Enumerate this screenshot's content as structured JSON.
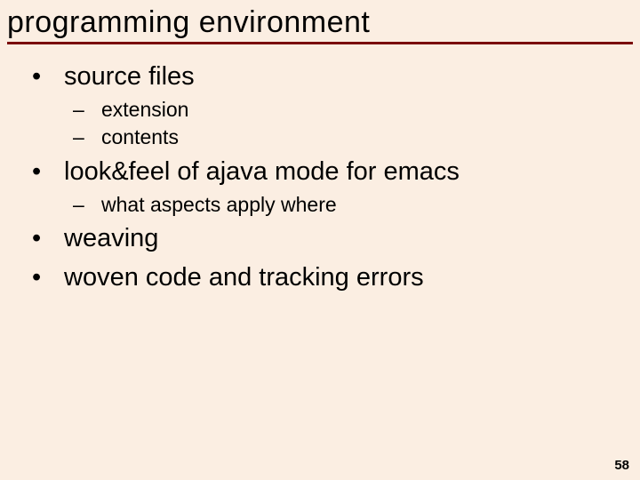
{
  "title": "programming environment",
  "bullets": {
    "b1": "source files",
    "b1a": "extension",
    "b1b": "contents",
    "b2": "look&feel of ajava mode for emacs",
    "b2a": "what aspects apply where",
    "b3": "weaving",
    "b4": "woven code and tracking errors"
  },
  "page_number": "58"
}
